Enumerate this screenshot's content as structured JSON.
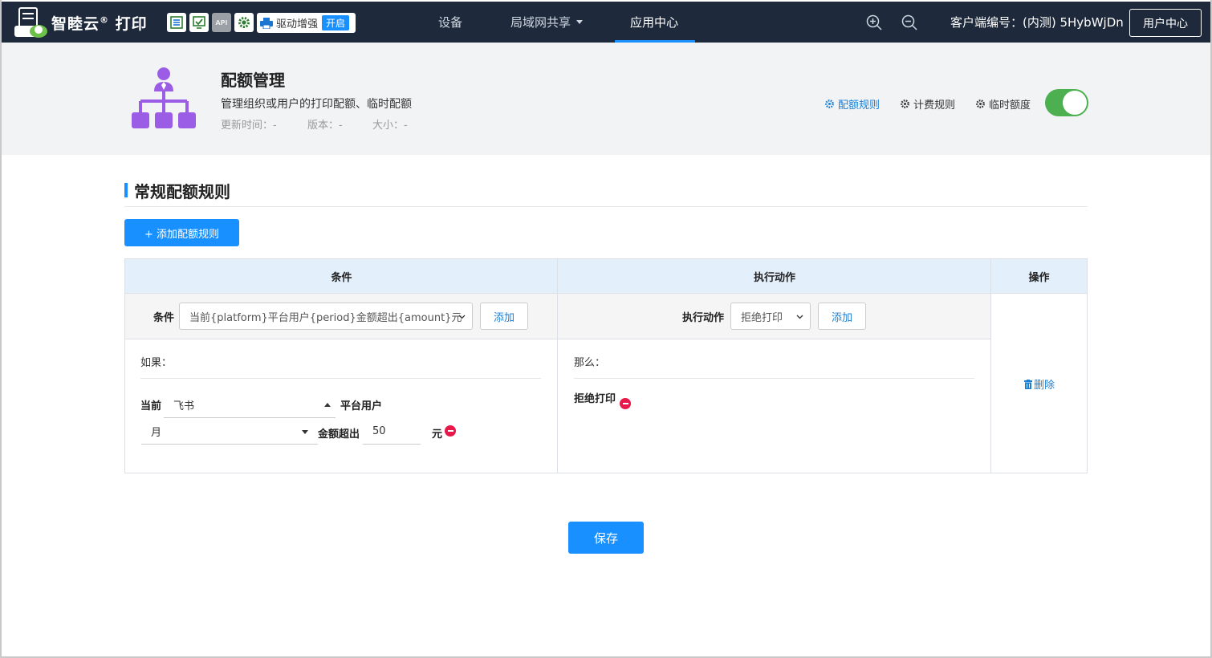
{
  "topbar": {
    "brand": "智睦云",
    "brand_reg": "®",
    "brand_suffix": " 打印",
    "tools": [
      "list-icon",
      "monitor-check-icon",
      "api-icon",
      "gear-icon"
    ],
    "api_label": "API",
    "driver_label": "驱动增强",
    "driver_badge": "开启",
    "nav": [
      {
        "label": "设备"
      },
      {
        "label": "局域网共享"
      },
      {
        "label": "应用中心"
      }
    ],
    "client_id": "客户端编号：(内测) 5HybWjDn",
    "user_center": "用户中心"
  },
  "app": {
    "title": "配额管理",
    "description": "管理组织或用户的打印配额、临时配额",
    "updated": "更新时间：-",
    "version": "版本：-",
    "size": "大小：-",
    "links": {
      "quota_rules": "配额规则",
      "billing_rules": "计费规则",
      "temp_quota": "临时额度"
    },
    "temp_quota_enabled": true,
    "accent_color": "#9b5de5"
  },
  "section": {
    "title": "常规配额规则",
    "add_button": "+ 添加配额规则"
  },
  "table": {
    "headers": {
      "condition": "条件",
      "action": "执行动作",
      "operation": "操作"
    },
    "condition_label": "条件",
    "condition_select": "当前{platform}平台用户{period}金额超出{amount}元",
    "condition_add": "添加",
    "action_label": "执行动作",
    "action_select": "拒绝打印",
    "action_add": "添加",
    "if_label": "如果：",
    "then_label": "那么：",
    "current_label": "当前",
    "platform_value": "飞书",
    "platform_user_label": "平台用户",
    "period_value": "月",
    "amount_exceed_label": "金额超出",
    "amount_value": "50",
    "yuan_label": "元",
    "action_item": "拒绝打印",
    "delete_label": "删除"
  },
  "save_button": "保存",
  "colors": {
    "nav_bg": "#1e2a3c",
    "primary": "#1890ff",
    "toggle_on": "#4caf50",
    "danger": "#e8194a"
  }
}
